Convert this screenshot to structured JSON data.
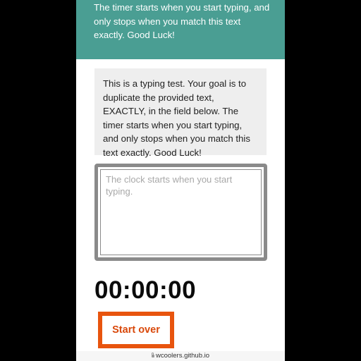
{
  "header": {
    "text": "The timer starts when you start typing, and only stops when you match this text exactly. Good Luck!"
  },
  "prompt": {
    "text": "This is a typing test. Your goal is to duplicate the provided text, EXACTLY, in the field below. The timer starts when you start typing, and only stops when you match this text exactly. Good Luck!"
  },
  "input": {
    "placeholder": "The clock starts when you start typing.",
    "value": ""
  },
  "timer": {
    "display": "00:00:00"
  },
  "buttons": {
    "start_over_label": "Start over"
  },
  "browser": {
    "url": "wcoolers.github.io"
  },
  "colors": {
    "header_bg": "#4a9e93",
    "button_border": "#e8540e",
    "button_text": "#d9480a",
    "prompt_bg": "#eeeeee"
  },
  "icons": {
    "url_lock": "lock-icon"
  }
}
